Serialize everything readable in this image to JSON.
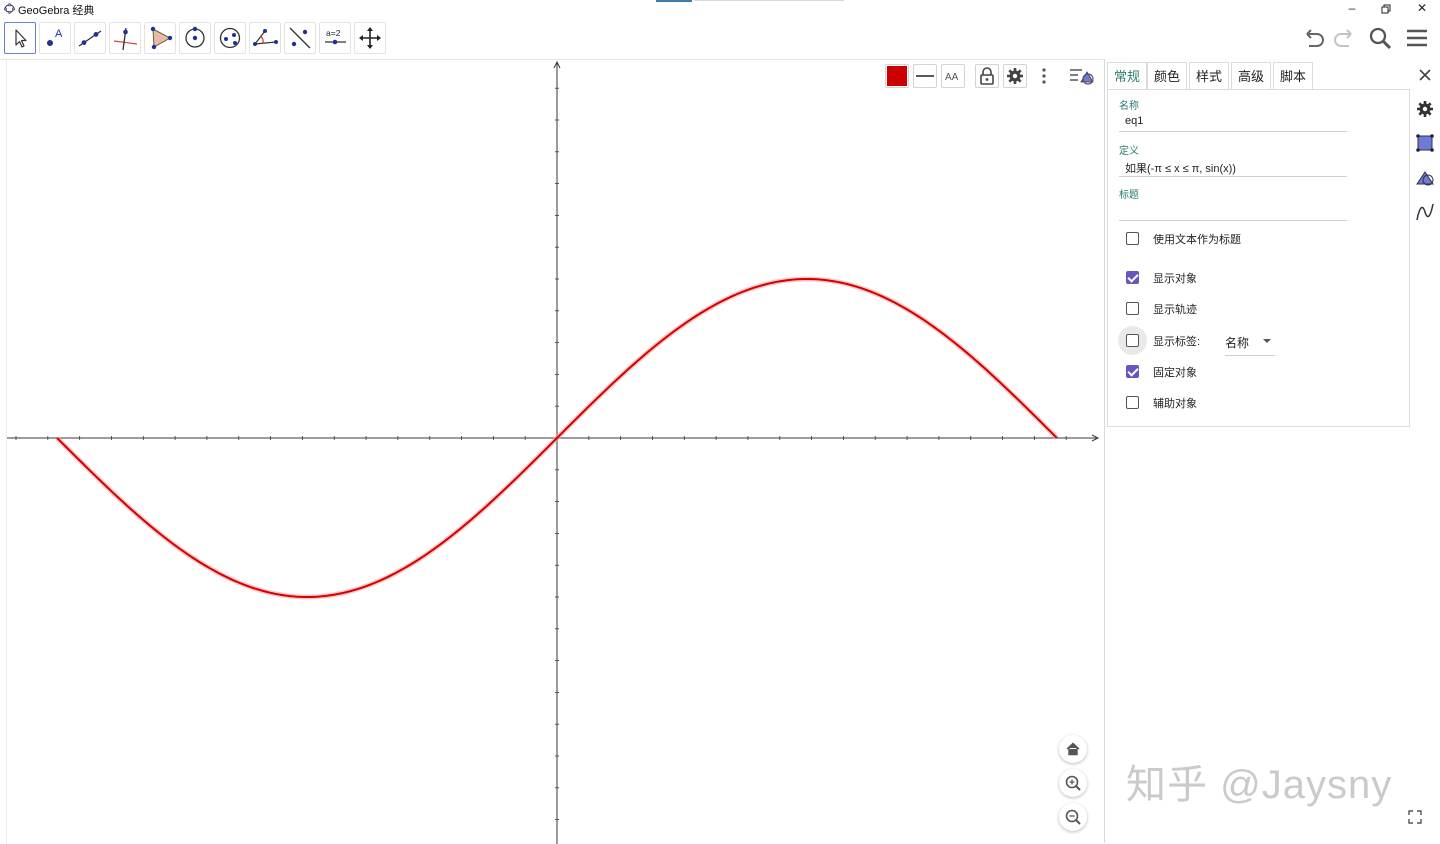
{
  "window": {
    "title": "GeoGebra 经典",
    "controls": [
      "minimize",
      "restore",
      "close"
    ]
  },
  "toolbar": {
    "tools": [
      {
        "name": "move-tool",
        "icon": "arrow-cursor-icon",
        "active": true
      },
      {
        "name": "point-tool",
        "icon": "point-icon",
        "glyph": "A"
      },
      {
        "name": "line-tool",
        "icon": "line-through-points-icon"
      },
      {
        "name": "perpendicular-tool",
        "icon": "perpendicular-line-icon"
      },
      {
        "name": "polygon-tool",
        "icon": "polygon-icon"
      },
      {
        "name": "circle-tool",
        "icon": "circle-center-point-icon"
      },
      {
        "name": "ellipse-tool",
        "icon": "ellipse-icon"
      },
      {
        "name": "angle-tool",
        "icon": "angle-icon"
      },
      {
        "name": "reflect-tool",
        "icon": "reflect-about-line-icon"
      },
      {
        "name": "slider-tool",
        "icon": "slider-icon",
        "glyph": "a=2"
      },
      {
        "name": "move-view-tool",
        "icon": "move-graphics-view-icon"
      }
    ],
    "right": [
      "undo-icon",
      "redo-icon",
      "search-icon",
      "menu-icon"
    ]
  },
  "graphics": {
    "function": "sin(x)",
    "domain": [
      "-π",
      "π"
    ],
    "curve_color": "#d40000",
    "stylebar": {
      "color_swatch": "#cc0000",
      "buttons": [
        "color-swatch",
        "line-style-icon",
        "label-style-icon",
        "lock-icon",
        "gear-icon",
        "more-vertical-icon",
        "toggle-stylebar-icon"
      ],
      "label_glyph": "AA"
    },
    "zoom_controls": [
      "home-icon",
      "zoom-in-icon",
      "zoom-out-icon"
    ]
  },
  "chart_data": {
    "type": "line",
    "series": [
      {
        "values": [
          [
            -3.14159,
            0
          ],
          [
            -1.5708,
            -1
          ],
          [
            0,
            0
          ],
          [
            1.5708,
            1
          ],
          [
            3.14159,
            0
          ]
        ]
      }
    ],
    "xlim": [
      -3.5,
      3.4
    ],
    "ylim": [
      -2.5,
      2.5
    ],
    "grid": false
  },
  "properties": {
    "tabs": [
      "常规",
      "颜色",
      "样式",
      "高级",
      "脚本"
    ],
    "active_tab": 0,
    "name_label": "名称",
    "name_value": "eq1",
    "definition_label": "定义",
    "definition_value": "如果(-π ≤ x ≤ π, sin(x))",
    "caption_label": "标题",
    "caption_value": "",
    "checkboxes": [
      {
        "label": "使用文本作为标题",
        "checked": false
      },
      {
        "label": "显示对象",
        "checked": true
      },
      {
        "label": "显示轨迹",
        "checked": false
      },
      {
        "label": "显示标签:",
        "checked": false
      },
      {
        "label": "固定对象",
        "checked": true
      },
      {
        "label": "辅助对象",
        "checked": false
      }
    ],
    "label_dropdown": "名称",
    "side_icons": [
      "gear-icon",
      "graphics-view-icon",
      "algebra-shapes-icon",
      "function-icon"
    ]
  },
  "watermark": "知乎 @Jaysny"
}
